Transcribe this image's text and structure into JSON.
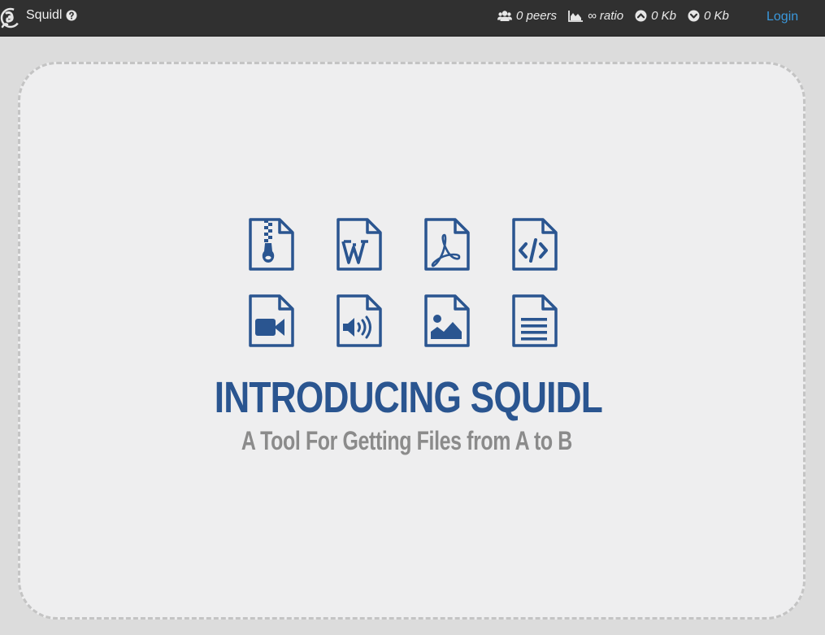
{
  "header": {
    "app_name": "Squidl",
    "login_label": "Login",
    "stats": {
      "peers": "0 peers",
      "ratio": "∞ ratio",
      "upload": "0 Kb",
      "download": "0 Kb"
    }
  },
  "hero": {
    "title": "INTRODUCING SQUIDL",
    "subtitle": "A Tool For Getting Files from A to B"
  },
  "file_icons": [
    "zip-file-icon",
    "word-file-icon",
    "pdf-file-icon",
    "code-file-icon",
    "video-file-icon",
    "audio-file-icon",
    "image-file-icon",
    "text-file-icon"
  ],
  "colors": {
    "topbar": "#303030",
    "accent_link": "#3a98dc",
    "icon_blue": "#2a5590",
    "subtitle_gray": "#8b8b8b",
    "dropzone_bg": "#eeeeef"
  }
}
